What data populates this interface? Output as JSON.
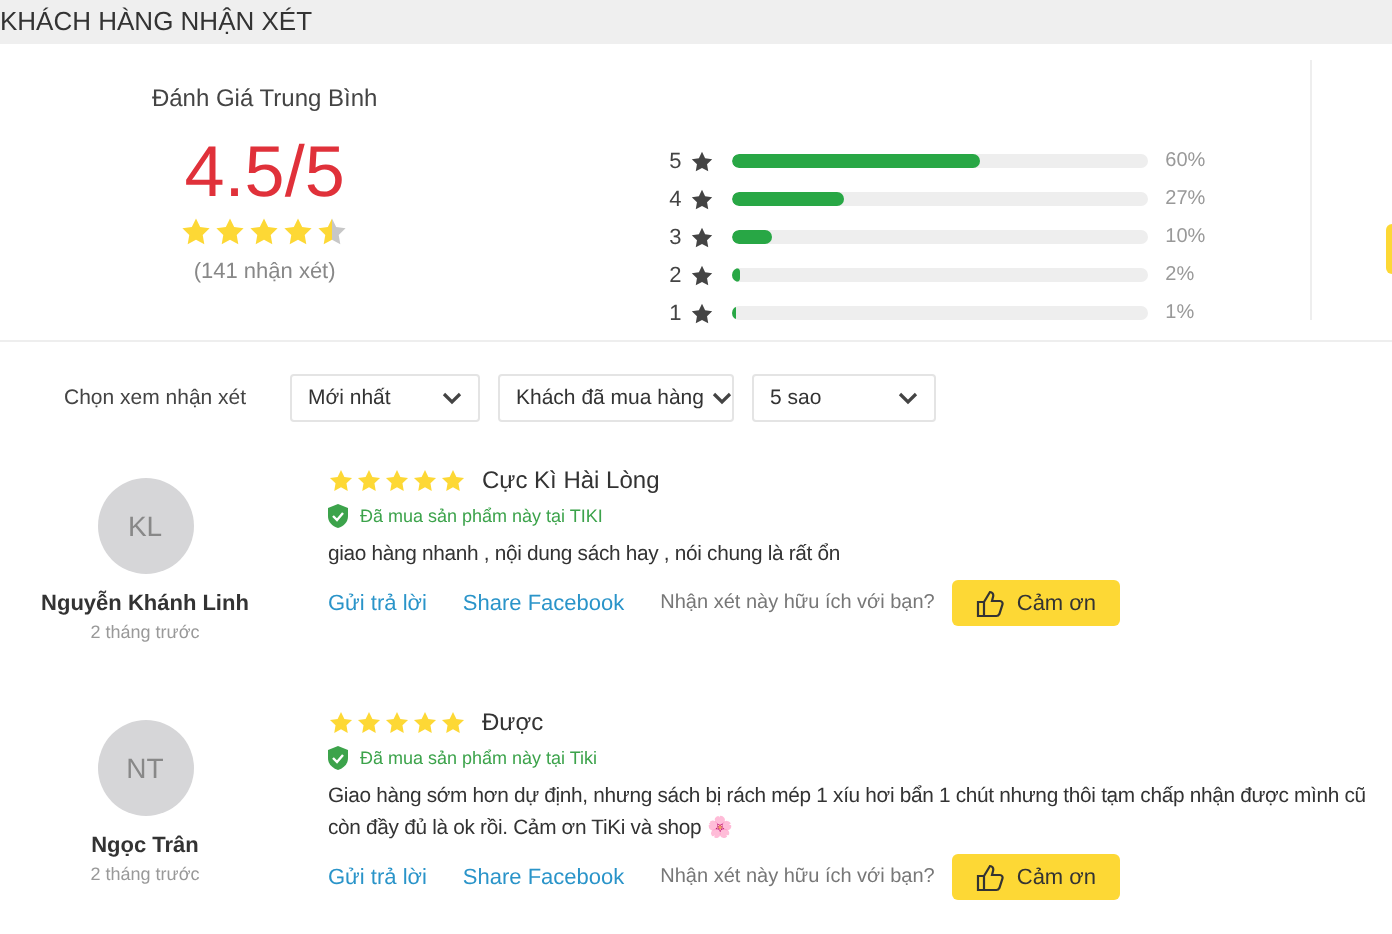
{
  "header": {
    "title": "KHÁCH HÀNG NHẬN XÉT"
  },
  "summary": {
    "label": "Đánh Giá Trung Bình",
    "score": "4.5/5",
    "stars": 4.5,
    "count": "(141 nhận xét)"
  },
  "distribution": [
    {
      "stars_label": "5",
      "level": 0.6,
      "percent": "60%"
    },
    {
      "stars_label": "4",
      "level": 0.27,
      "percent": "27%"
    },
    {
      "stars_label": "3",
      "level": 0.1,
      "percent": "10%"
    },
    {
      "stars_label": "2",
      "level": 0.02,
      "percent": "2%"
    },
    {
      "stars_label": "1",
      "level": 0.01,
      "percent": "1%"
    }
  ],
  "filters": {
    "label": "Chọn xem nhận xét",
    "selects": [
      {
        "value": "Mới nhất"
      },
      {
        "value": "Khách đã mua hàng"
      },
      {
        "value": "5 sao"
      }
    ]
  },
  "reviews": [
    {
      "initials": "KL",
      "name": "Nguyễn Khánh Linh",
      "time": "2 tháng trước",
      "stars": 5,
      "title": "Cực Kì Hài Lòng",
      "verified": "Đã mua sản phẩm này tại TIKI",
      "text": [
        "giao hàng nhanh , nội dung sách hay , nói chung là rất ổn"
      ],
      "reply": "Gửi trả lời",
      "share": "Share Facebook",
      "helpful": "Nhận xét này hữu ích với bạn?",
      "thanks": "Cảm ơn"
    },
    {
      "initials": "NT",
      "name": "Ngọc Trân",
      "time": "2 tháng trước",
      "stars": 5,
      "title": "Được",
      "verified": "Đã mua sản phẩm này tại Tiki",
      "text": [
        "Giao hàng sớm hơn dự định, nhưng sách bị rách mép 1 xíu hơi bẩn 1 chút nhưng thôi tạm chấp nhận được mình cũ",
        "còn đầy đủ là ok rồi. Cảm ơn TiKi và shop 🌸"
      ],
      "reply": "Gửi trả lời",
      "share": "Share Facebook",
      "helpful": "Nhận xét này hữu ích với bạn?",
      "thanks": "Cảm ơn"
    }
  ]
}
